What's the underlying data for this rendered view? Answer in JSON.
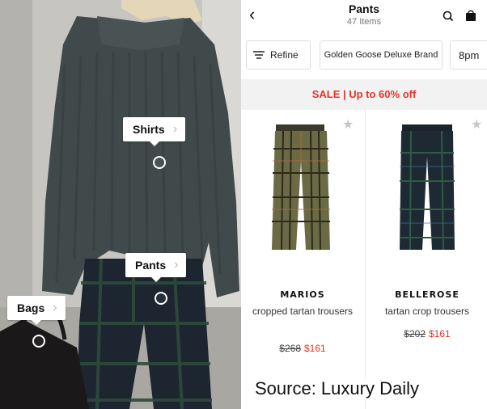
{
  "photo_tags": [
    {
      "label": "Shirts"
    },
    {
      "label": "Pants"
    },
    {
      "label": "Bags"
    }
  ],
  "header": {
    "back_icon": "chevron-left-icon",
    "title": "Pants",
    "item_count": "47 Items",
    "search_icon": "search-icon",
    "bag_icon": "shopping-bag-icon"
  },
  "filters": {
    "refine_label": "Refine",
    "chips": [
      "Golden Goose Deluxe Brand",
      "8pm"
    ]
  },
  "sale_banner": "SALE | Up to 60% off",
  "products": [
    {
      "brand": "MARIOS",
      "name": "cropped tartan trousers",
      "original_price": "$268",
      "sale_price": "$161"
    },
    {
      "brand": "BELLEROSE",
      "name": "tartan crop trousers",
      "original_price": "$202",
      "sale_price": "$161"
    }
  ],
  "source_caption": "Source: Luxury Daily",
  "colors": {
    "sale_red": "#e2342c",
    "text_dark": "#111111"
  }
}
